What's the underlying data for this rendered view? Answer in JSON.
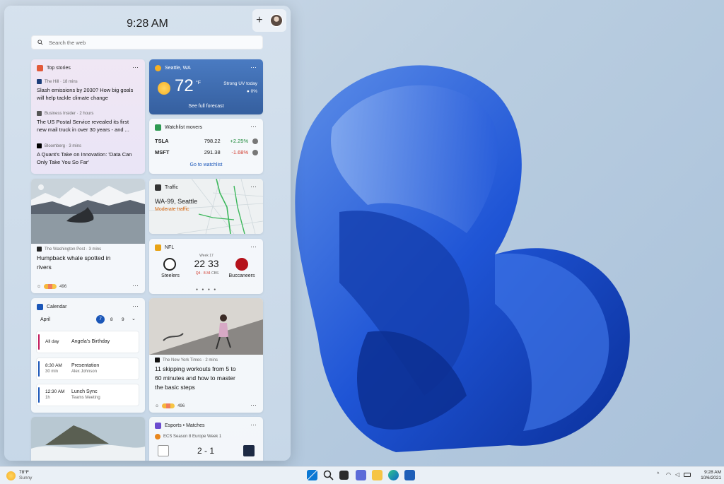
{
  "panel": {
    "time": "9:28 AM",
    "search_placeholder": "Search the web",
    "add_label": "+"
  },
  "top_stories": {
    "title": "Top stories",
    "more": "···",
    "items": [
      {
        "source": "The Hill · 18 mins",
        "line1": "Slash emissions by 2030? How big goals",
        "line2": "will help tackle climate change"
      },
      {
        "source": "Business Insider · 2 hours",
        "line1": "The US Postal Service revealed its first",
        "line2": "new mail truck in over 30 years - and ..."
      },
      {
        "source": "Bloomberg · 3 mins",
        "line1": "A Quant's Take on Innovation: 'Data Can",
        "line2": "Only Take You So Far'"
      }
    ]
  },
  "weather": {
    "location": "Seattle, WA",
    "temp": "72",
    "unit": "°F",
    "uv_label": "Strong UV today",
    "precip": "0%",
    "link": "See full forecast",
    "more": "···"
  },
  "watchlist": {
    "title": "Watchlist movers",
    "more": "···",
    "stocks": [
      {
        "symbol": "TSLA",
        "price": "798.22",
        "change": "+2.25%"
      },
      {
        "symbol": "MSFT",
        "price": "291.38",
        "change": "-1.68%"
      }
    ],
    "link": "Go to watchlist",
    "colors": {
      "up": "#1f8a3b",
      "down": "#d13a2c"
    }
  },
  "whale": {
    "source": "The Washington Post · 3 mins",
    "line1": "Humpback whale spotted in",
    "line2": "rivers",
    "reactions": "496",
    "more": "···"
  },
  "traffic": {
    "title": "Traffic",
    "road": "WA-99, Seattle",
    "status": "Moderate traffic",
    "more": "···"
  },
  "nfl": {
    "title": "NFL",
    "week": "Week 17",
    "home_team": "Steelers",
    "away_team": "Buccaneers",
    "home_score": "22",
    "away_score": "33",
    "clock": "Q4 · 8:34",
    "network": "CBS",
    "more": "···"
  },
  "calendar": {
    "title": "Calendar",
    "month": "April",
    "days": [
      "7",
      "8",
      "9"
    ],
    "events": [
      {
        "time": "All day",
        "duration": "",
        "name": "Angela's Birthday",
        "detail": "",
        "color": "#c2185b"
      },
      {
        "time": "8:30 AM",
        "duration": "30 min",
        "name": "Presentation",
        "detail": "Alex Johnson",
        "color": "#1a56b8"
      },
      {
        "time": "12:30 AM",
        "duration": "1h",
        "name": "Lunch Sync",
        "detail": "Teams Meeting",
        "color": "#1a56b8"
      }
    ]
  },
  "skipping": {
    "source": "The New York Times · 2 mins",
    "line1": "11 skipping workouts from 5 to",
    "line2": "60 minutes and how to master",
    "line3": "the basic steps",
    "reactions": "496",
    "more": "···"
  },
  "esports": {
    "title": "Esports • Matches",
    "event": "ECS Season 8 Europe Week 1",
    "score": "2 - 1",
    "more": "···"
  },
  "taskbar": {
    "weather_temp": "78°F",
    "weather_cond": "Sunny",
    "time": "9:28 AM",
    "date": "10/6/2021"
  }
}
